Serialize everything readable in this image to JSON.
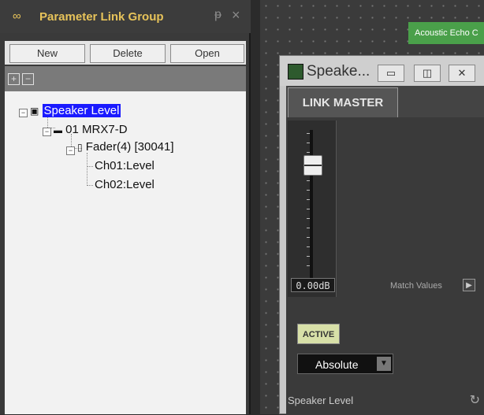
{
  "panel": {
    "title": "Parameter Link Group",
    "toolbar": {
      "new": "New",
      "delete": "Delete",
      "open": "Open"
    },
    "tree": [
      {
        "label": "Speaker Level",
        "selected": true
      },
      {
        "label": "01 MRX7-D"
      },
      {
        "label": "Fader(4) [30041]"
      },
      {
        "label": "Ch01:Level"
      },
      {
        "label": "Ch02:Level"
      }
    ]
  },
  "canvas": {
    "component_label": "Acoustic Echo C"
  },
  "window": {
    "title": "Speake...",
    "tab": "LINK MASTER",
    "fader_value": "0.00dB",
    "match_values_label": "Match Values",
    "active_label": "ACTIVE",
    "mode_value": "Absolute",
    "status": "Speaker Level"
  }
}
